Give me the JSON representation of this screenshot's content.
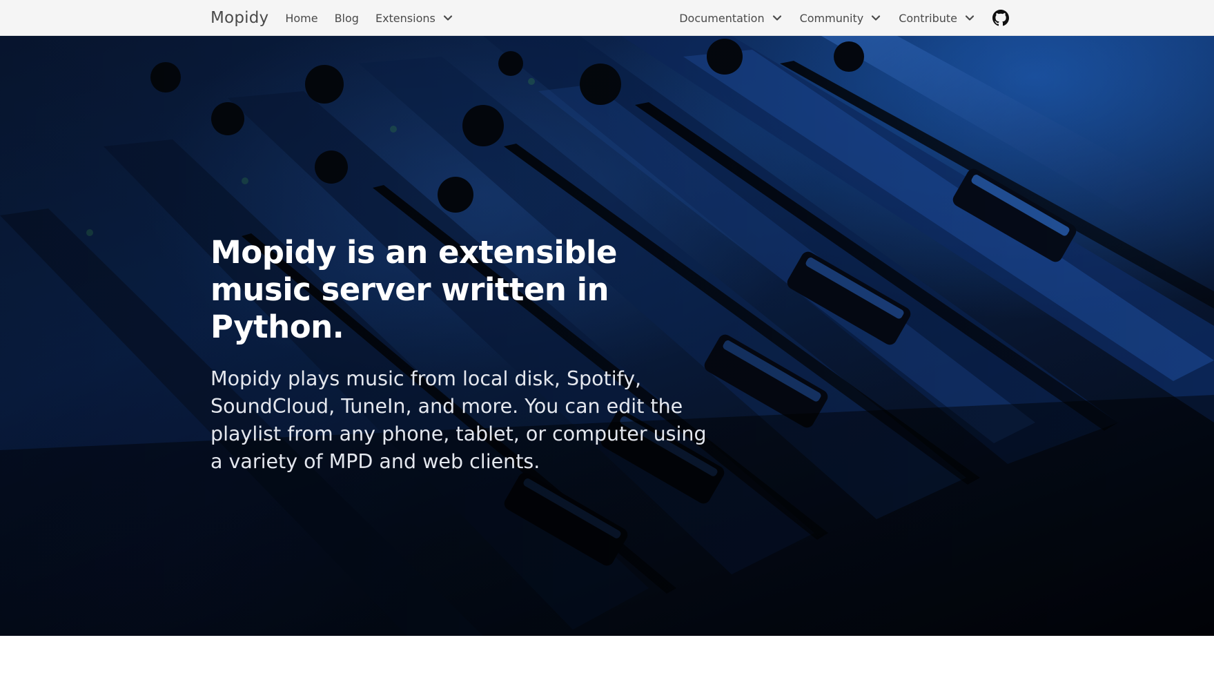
{
  "navbar": {
    "brand": "Mopidy",
    "left_links": [
      {
        "label": "Home",
        "has_dropdown": false
      },
      {
        "label": "Blog",
        "has_dropdown": false
      },
      {
        "label": "Extensions",
        "has_dropdown": true
      }
    ],
    "right_links": [
      {
        "label": "Documentation",
        "has_dropdown": true
      },
      {
        "label": "Community",
        "has_dropdown": true
      },
      {
        "label": "Contribute",
        "has_dropdown": true
      }
    ],
    "github_icon": "github-icon",
    "dropdown_icon": "chevron-down-icon",
    "text_color": "#4a4a4a",
    "background": "#f5f5f5"
  },
  "hero": {
    "title": "Mopidy is an extensible music server written in Python.",
    "subtitle": "Mopidy plays music from local disk, Spotify, SoundCloud, TuneIn, and more. You can edit the playlist from any phone, tablet, or computer using a variety of MPD and web clients.",
    "accent_color": "#1f6fd6"
  }
}
